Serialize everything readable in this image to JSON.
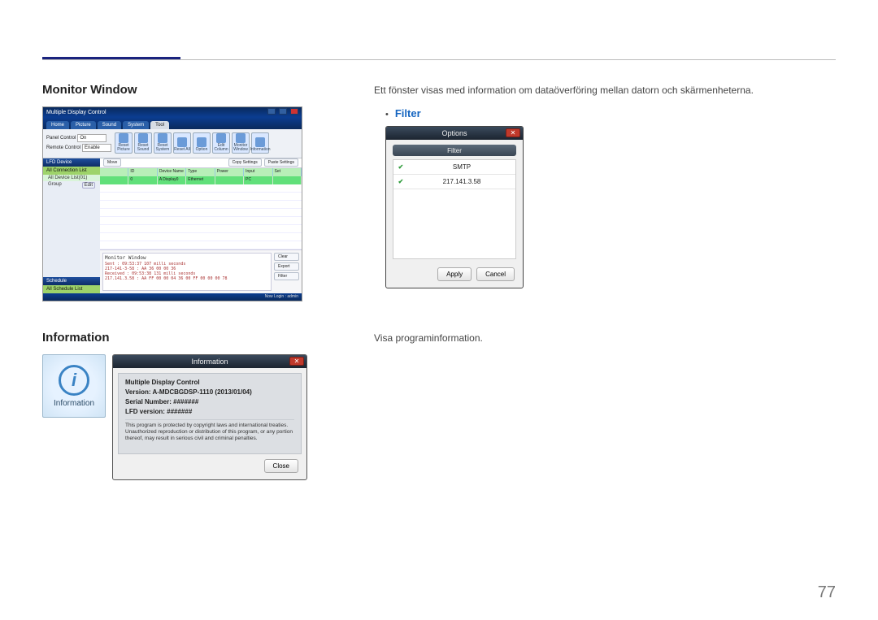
{
  "page_number": "77",
  "sections": {
    "monitor": {
      "heading": "Monitor Window",
      "desc": "Ett fönster visas med information om dataöverföring mellan datorn och skärmenheterna.",
      "filter_label": "Filter"
    },
    "information": {
      "heading": "Information",
      "desc": "Visa programinformation."
    }
  },
  "mdc": {
    "app_title": "Multiple Display Control",
    "tabs": [
      "Home",
      "Picture",
      "Sound",
      "System",
      "Tool"
    ],
    "active_tab": "Tool",
    "panel_rows": [
      {
        "label": "Panel Control",
        "value": "On"
      },
      {
        "label": "Remote Control",
        "value": "Enable"
      }
    ],
    "tool_buttons": [
      "Reset Picture",
      "Reset Sound",
      "Reset System",
      "Reset All",
      "Option",
      "Edit Column",
      "Monitor Window",
      "Information"
    ],
    "action_buttons": [
      "Move",
      "Copy Settings",
      "Paste Settings"
    ],
    "side": {
      "hd1": "LFD Device",
      "grn1": "All Connection List",
      "item_count": "All Device List(01)",
      "group": "Group",
      "edit": "Edit",
      "hd2": "Schedule",
      "grn2": "All Schedule List"
    },
    "table": {
      "headers": [
        "",
        "ID",
        "Device Name",
        "Type",
        "Power",
        "Input",
        "Set"
      ],
      "row": [
        "",
        "0",
        "A Display0",
        "Ethernet",
        "",
        "PC",
        ""
      ]
    },
    "monitor_panel": {
      "label": "Monitor Window",
      "log1": "Sent : 09:53:37 107 milli seconds",
      "log2": "217-141-3-58 : AA 36 00 00 36",
      "log3": "Received : 09:53:38 131 milli seconds",
      "log4": "217.141.3.58 : AA FF 00 00 04 36 00 FF 00 00 00 78",
      "buttons": [
        "Clear",
        "Export",
        "Filter"
      ]
    },
    "status": "Now Login : admin"
  },
  "options_dialog": {
    "title": "Options",
    "subtitle": "Filter",
    "rows": [
      "SMTP",
      "217.141.3.58"
    ],
    "buttons": {
      "apply": "Apply",
      "cancel": "Cancel"
    }
  },
  "info_tile": {
    "caption": "Information"
  },
  "info_dialog": {
    "title": "Information",
    "product": "Multiple Display Control",
    "version": "Version: A-MDCBGDSP-1110 (2013/01/04)",
    "serial": "Serial Number: #######",
    "lfd": "LFD version: #######",
    "legal": "This program is protected by copyright laws and international treaties. Unauthorized reproduction or distribution of this program, or any portion thereof, may result in serious civil and criminal penalties.",
    "close": "Close"
  }
}
